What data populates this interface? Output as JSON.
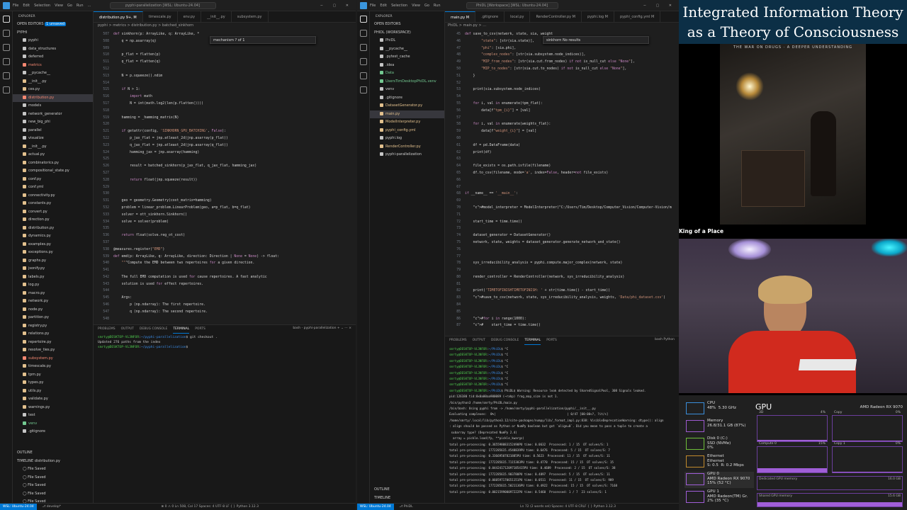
{
  "left_window": {
    "title": "pyphi-parallelization [WSL: Ubuntu-24.04]",
    "menu": [
      "File",
      "Edit",
      "Selection",
      "View",
      "Go",
      "Run",
      "…"
    ],
    "explorer_title": "EXPLORER",
    "open_editors": "OPEN EDITORS",
    "open_editors_badge": "1 unsaved",
    "root": "PYPHI",
    "files": [
      {
        "name": "pyphi",
        "cls": "",
        "dot": "#c5c5c5"
      },
      {
        "name": "data_structures",
        "cls": "",
        "dot": "#c5c5c5"
      },
      {
        "name": "deferred",
        "cls": "",
        "dot": "#c5c5c5"
      },
      {
        "name": "metrics",
        "cls": "err",
        "dot": "#f48771"
      },
      {
        "name": "__pycache__",
        "cls": "",
        "dot": "#c5c5c5"
      },
      {
        "name": "__init__.py",
        "cls": "",
        "dot": "#e2c08d"
      },
      {
        "name": "ces.py",
        "cls": "",
        "dot": "#e2c08d"
      },
      {
        "name": "distribution.py",
        "cls": "err sel",
        "dot": "#f48771"
      },
      {
        "name": "models",
        "cls": "",
        "dot": "#c5c5c5"
      },
      {
        "name": "network_generator",
        "cls": "",
        "dot": "#c5c5c5"
      },
      {
        "name": "new_big_phi",
        "cls": "",
        "dot": "#c5c5c5"
      },
      {
        "name": "parallel",
        "cls": "",
        "dot": "#c5c5c5"
      },
      {
        "name": "visualize",
        "cls": "",
        "dot": "#c5c5c5"
      },
      {
        "name": "__init__.py",
        "cls": "",
        "dot": "#e2c08d"
      },
      {
        "name": "actual.py",
        "cls": "",
        "dot": "#e2c08d"
      },
      {
        "name": "combinatorics.py",
        "cls": "",
        "dot": "#e2c08d"
      },
      {
        "name": "compositional_state.py",
        "cls": "",
        "dot": "#e2c08d"
      },
      {
        "name": "conf.py",
        "cls": "",
        "dot": "#e2c08d"
      },
      {
        "name": "conf.yml",
        "cls": "",
        "dot": "#e2c08d"
      },
      {
        "name": "connectivity.py",
        "cls": "",
        "dot": "#e2c08d"
      },
      {
        "name": "constants.py",
        "cls": "",
        "dot": "#e2c08d"
      },
      {
        "name": "convert.py",
        "cls": "",
        "dot": "#e2c08d"
      },
      {
        "name": "direction.py",
        "cls": "",
        "dot": "#e2c08d"
      },
      {
        "name": "distribution.py",
        "cls": "",
        "dot": "#e2c08d"
      },
      {
        "name": "dynamics.py",
        "cls": "",
        "dot": "#e2c08d"
      },
      {
        "name": "examples.py",
        "cls": "",
        "dot": "#e2c08d"
      },
      {
        "name": "exceptions.py",
        "cls": "",
        "dot": "#e2c08d"
      },
      {
        "name": "graphs.py",
        "cls": "",
        "dot": "#e2c08d"
      },
      {
        "name": "jsonify.py",
        "cls": "",
        "dot": "#e2c08d"
      },
      {
        "name": "labels.py",
        "cls": "",
        "dot": "#e2c08d"
      },
      {
        "name": "log.py",
        "cls": "",
        "dot": "#e2c08d"
      },
      {
        "name": "macro.py",
        "cls": "",
        "dot": "#e2c08d"
      },
      {
        "name": "network.py",
        "cls": "",
        "dot": "#e2c08d"
      },
      {
        "name": "node.py",
        "cls": "",
        "dot": "#e2c08d"
      },
      {
        "name": "partition.py",
        "cls": "",
        "dot": "#e2c08d"
      },
      {
        "name": "registry.py",
        "cls": "",
        "dot": "#e2c08d"
      },
      {
        "name": "relations.py",
        "cls": "",
        "dot": "#e2c08d"
      },
      {
        "name": "repertoire.py",
        "cls": "",
        "dot": "#e2c08d"
      },
      {
        "name": "resolve_ties.py",
        "cls": "",
        "dot": "#e2c08d"
      },
      {
        "name": "subsystem.py",
        "cls": "err",
        "dot": "#f48771"
      },
      {
        "name": "timescale.py",
        "cls": "",
        "dot": "#e2c08d"
      },
      {
        "name": "tpm.py",
        "cls": "",
        "dot": "#e2c08d"
      },
      {
        "name": "types.py",
        "cls": "",
        "dot": "#e2c08d"
      },
      {
        "name": "utils.py",
        "cls": "",
        "dot": "#e2c08d"
      },
      {
        "name": "validate.py",
        "cls": "",
        "dot": "#e2c08d"
      },
      {
        "name": "warnings.py",
        "cls": "",
        "dot": "#e2c08d"
      },
      {
        "name": "test",
        "cls": "",
        "dot": "#c5c5c5"
      },
      {
        "name": "venv",
        "cls": "ok",
        "dot": "#73c991"
      },
      {
        "name": ".gitignore",
        "cls": "",
        "dot": "#c5c5c5"
      }
    ],
    "outline": "OUTLINE",
    "timeline": "TIMELINE  distribution.py",
    "timeline_items": [
      "File Saved",
      "File Saved",
      "File Saved",
      "File Saved",
      "File Saved"
    ],
    "tabs": [
      {
        "label": "distribution.py  9+, M",
        "on": true
      },
      {
        "label": "timescale.py",
        "on": false
      },
      {
        "label": "env.py",
        "on": false
      },
      {
        "label": "__init__.py",
        "on": false
      },
      {
        "label": "subsystem.py",
        "on": false
      }
    ],
    "breadcrumb": "pyphi > metrics > distribution.py > batched_sinkhorn",
    "find_widget": "mechanism            ? of 1",
    "line_numbers": "507\n508\n509\n510\n511\n512\n513\n514\n515\n516\n517\n518\n519\n520\n521\n522\n523\n524\n525\n526\n527\n528\n529\n530\n531\n532\n533\n534\n535\n536\n537\n538\n539\n540\n541\n542\n543\n544\n545\n546\n547\n548\n549\n550\n551",
    "code": [
      "def sinkhorn(p: ArrayLike, q: ArrayLike, *",
      "    q = np.asarray(q)",
      "",
      "    p_flat = flatten(p)",
      "    q_flat = flatten(q)",
      "",
      "    N = p.squeeze().ndim",
      "",
      "    if N > 1:",
      "        import math",
      "        N = int(math.log2(len(p.flatten())))",
      "",
      "    hamming = _hamming_matrix(N)",
      "",
      "    if getattr(config, 'SINKHORN_GPU_BATCHING', False):",
      "        p_jax_flat = jnp.atleast_2d(jnp.asarray(p_flat))",
      "        q_jax_flat = jnp.atleast_2d(jnp.asarray(q_flat))",
      "        hamming_jax = jnp.asarray(hamming)",
      "",
      "        result = batched_sinkhorn(p_jax_flat, q_jax_flat, hamming_jax)",
      "",
      "        return float(jnp.squeeze(result))",
      "",
      "",
      "    geo = geometry.Geometry(cost_matrix=hamming)",
      "    problem = linear_problem.LinearProblem(geo, a=p_flat, b=q_flat)",
      "    solver = ott_sinkhorn.Sinkhorn()",
      "    solve = solver(problem)",
      "",
      "    return float(solve.reg_ot_cost)",
      "",
      "@measures.register(\"EMD\")",
      "def emd(p: ArrayLike, q: ArrayLike, direction: Direction | None = None) -> float:",
      "    \"\"\"Compute the EMD between two repertoires for a given direction.",
      "",
      "    The full EMD computation is used for cause repertoires. A fast analytic",
      "    solution is used for effect repertoires.",
      "",
      "    Args:",
      "        p (np.ndarray): The first repertoire.",
      "        q (np.ndarray): The second repertoire."
    ],
    "panel_tabs": [
      "PROBLEMS",
      "OUTPUT",
      "DEBUG CONSOLE",
      "TERMINAL",
      "PORTS"
    ],
    "panel_right": "bash - pyphi-parallelization  +  ⌄  ⋯  ×",
    "terminal": [
      "smrty@DESKTOP-VL3NFOR:~/pyphi-parallelization$ git checkout .",
      "Updated 276 paths from the index",
      "smrty@DESKTOP-VL3NFOR:~/pyphi-parallelization$ "
    ],
    "status": "⊗ 0 ⚠ 0    Ln 508, Col 17   Spaces: 4   UTF-8   LF   { } Python   3.12.3",
    "remote": "WSL: Ubuntu-24.04",
    "branch": "⎇ develop*"
  },
  "middle_window": {
    "title": "PhiDL [Workspace] [WSL: Ubuntu-24.04]",
    "explorer_title": "EXPLORER",
    "open_editors": "OPEN EDITORS",
    "root": "PHIDL (WORKSPACE)",
    "files": [
      {
        "name": "PhiDL",
        "cls": "",
        "dot": "#c5c5c5"
      },
      {
        "name": "__pycache__",
        "cls": "",
        "dot": "#c5c5c5"
      },
      {
        "name": ".pytest_cache",
        "cls": "",
        "dot": "#c5c5c5"
      },
      {
        "name": ".idea",
        "cls": "",
        "dot": "#c5c5c5"
      },
      {
        "name": "Data",
        "cls": "ok",
        "dot": "#73c991"
      },
      {
        "name": "UsersTimDesktopPhiDL.venv",
        "cls": "ok",
        "dot": "#73c991"
      },
      {
        "name": "venv",
        "cls": "",
        "dot": "#c5c5c5"
      },
      {
        "name": ".gitignore",
        "cls": "",
        "dot": "#c5c5c5"
      },
      {
        "name": "DatasetGenerator.py",
        "cls": "mod",
        "dot": "#e2c08d"
      },
      {
        "name": "main.py",
        "cls": "mod sel",
        "dot": "#e2c08d"
      },
      {
        "name": "ModelInterpreter.py",
        "cls": "mod",
        "dot": "#e2c08d"
      },
      {
        "name": "pyphi_config.yml",
        "cls": "mod",
        "dot": "#e2c08d"
      },
      {
        "name": "pyphi.log",
        "cls": "",
        "dot": "#c5c5c5"
      },
      {
        "name": "RenderController.py",
        "cls": "mod",
        "dot": "#e2c08d"
      },
      {
        "name": "pyphi-parallelization",
        "cls": "",
        "dot": "#c5c5c5"
      }
    ],
    "outline": "OUTLINE",
    "timeline": "TIMELINE",
    "tabs": [
      {
        "label": "main.py  M",
        "on": true
      },
      {
        "label": ".gitignore",
        "on": false
      },
      {
        "label": "local.py",
        "on": false
      },
      {
        "label": "RenderController.py  M",
        "on": false
      },
      {
        "label": "pyphi.log  M",
        "on": false
      },
      {
        "label": "pyphi_config.yml  M",
        "on": false
      }
    ],
    "breadcrumb": "PhiDL > main.py > …",
    "find_widget": "sinkhorn              No results",
    "line_numbers": "45\n46\n47\n48\n49\n50\n51\n52\n53\n54\n55\n56\n57\n58\n59\n60\n61\n62\n63\n64\n65\n66\n67\n68\n69\n70\n71\n72\n73\n74\n75\n76\n77\n78\n79\n80\n81\n82\n83\n84\n85\n86\n87",
    "code": [
      "def save_to_csv(network, state, sia, weight",
      "        \"state\": [str(sia.state)],",
      "        \"phi\": [sia.phi],",
      "        \"complex_nodes\": [str(sia.subsystem.node_indices)],",
      "        \"MIP_from_nodes\": [str(sia.cut.from_nodes) if not is_null_cut else \"None\"],",
      "        \"MIP_to_nodes\": [str(sia.cut.to_nodes) if not is_null_cut else \"None\"],",
      "    }",
      "",
      "    print(sia.subsystem.node_indices)",
      "",
      "    for i, val in enumerate(tpm_flat):",
      "        data[f\"tpm_{i}\"] = [val]",
      "",
      "    for i, val in enumerate(weights_flat):",
      "        data[f\"weight_{i}\"] = [val]",
      "",
      "    df = pd.DataFrame(data)",
      "    print(df)",
      "",
      "    file_exists = os.path.isfile(filename)",
      "    df.to_csv(filename, mode='a', index=False, header=not file_exists)",
      "",
      "",
      "if __name__ == '__main__':",
      "",
      "    #model_interpreter = ModelInterpreter(\"C:/Users/Tim/Desktop/Computer_Vision/Computer-Vision/m",
      "",
      "    start_time = time.time()",
      "",
      "    dataset_generator = DatasetGenerator()",
      "    network, state, weights = dataset_generator.generate_network_and_state()",
      "",
      "",
      "    sys_irreducibility_analysis = pyphi.compute.major_complex(network, state)",
      "",
      "    render_controller = RenderController(network, sys_irreducibility_analysis)",
      "",
      "    print('TIMETOFINISHTIMETOFINISH: ' + str(time.time() - start_time))",
      "    #save_to_csv(network, state, sys_irreducibility_analysis, weights, 'Data/phi_dataset.csv')",
      "",
      "",
      "    #for i in range(1000):",
      "    #    start_time = time.time()"
    ],
    "panel_tabs": [
      "PROBLEMS",
      "OUTPUT",
      "DEBUG CONSOLE",
      "TERMINAL",
      "PORTS"
    ],
    "panel_right": "bash  Python",
    "terminal": [
      "smrty@DESKTOP-VL3NFOR:~/PhiDL$ ^C",
      "smrty@DESKTOP-VL3NFOR:~/PhiDL$ ^C",
      "smrty@DESKTOP-VL3NFOR:~/PhiDL$ ^C",
      "smrty@DESKTOP-VL3NFOR:~/PhiDL$ ^C",
      "smrty@DESKTOP-VL3NFOR:~/PhiDL$ ^C",
      "smrty@DESKTOP-VL3NFOR:~/PhiDL$ ^C",
      "smrty@DESKTOP-VL3NFOR:~/PhiDL$ ^C",
      "smrty@DESKTOP-VL3NFOR:~/PhiDL$ PhiDL$ Warning: Resource leak detected by SharedSignalPool, 308 Signals leaked.",
      "pid:126180 tid:0x0a00aa900089 (~rahp) frag_map_size is not 1.",
      "/bin/python3 /home/smrty/PhiDL/main.py",
      "/bin/bash: Using pyphi from -> /home/smrty/pyphi-parallelization/pyphi/__init__.py",
      "Evaluating complexes:  0%|                                        | 0/47 [00:00<?, ?it/s]",
      "/home/smrty/.local/lib/python3.12/site-packages/numpy/lib/_format_impl.py:838: VisibleDeprecationWarning: dtype(): align",
      ": align should be passed as Python or NumPy boolean but got `align=0`. Did you mean to pass a tuple to create a",
      " subarray type? (Deprecated NumPy 2.4)",
      "  array = pickle.load(fp, **pickle_kwargs)",
      "total pre-processing: 0.365598083152490PU time: 0.0632  Processed: 1 / 15  OT solves/S: 1",
      "total pre-processing: 1772285615.4548839PU time: 0.6476  Processed: 5 / 15  OT solves/S: 7",
      "total pre-processing: 0.33669507821885PU time: 0.5623  Processed: 11 / 15  OT solves/S: 11",
      "total pre-processing: 1772285615.7115383PU time: 0.4770  Processed: 15 / 15  OT solves/S: 15",
      "total pre-processing: 0.044241712097185415PU time: 0.4689  Processed: 2 / 15  OT solves/S: 38",
      "total pre-processing: 1772285615.903780PU time: 0.4897  Processed: 5 / 15  OT solves/S: 11",
      "total pre-processing: 0.060597170651151PU time: 0.0511  Processed: 11 / 15  OT solves/S: 989",
      "total pre-processing: 1772285615.5021136PU time: 0.4922  Processed: 15 / 15  OT solves/S: 7168",
      "total pre-processing: 0.002159900097222PU time: 0.5460  Processed: 1 / 7  23 solves/S: 1"
    ],
    "status": "Ln 72 (2 words sel)   Spaces: 4   UTF-8   CRLF   { } Python   3.12.3",
    "remote": "WSL: Ubuntu-24.04",
    "branch": "⎇ PhiDL"
  },
  "right_panel": {
    "banner": "Integrated Information Theory as a Theory of Consciousness",
    "album_text": "THE WAR ON DRUGS · A DEEPER UNDERSTANDING",
    "song": "King of a Place",
    "task_manager": {
      "title": "GPU",
      "gpu_name": "AMD Radeon RX 9070",
      "items": [
        {
          "label": "CPU",
          "sub": "48%  5.30 GHz"
        },
        {
          "label": "Memory",
          "sub": "26.8/31.1 GB (87%)"
        },
        {
          "label": "Disk 0 (C:)",
          "sub": "SSD (NVMe)\n0%"
        },
        {
          "label": "Ethernet",
          "sub": "Ethernet\nS: 0.5  R: 0.2 Mbps"
        },
        {
          "label": "GPU 0",
          "sub": "AMD Radeon RX 9070\n15% (52 °C)"
        },
        {
          "label": "GPU 1",
          "sub": "AMD Radeon(TM) Gr.\n2% (35 °C)"
        }
      ],
      "graphs": [
        {
          "label": "3D",
          "pct": "4%"
        },
        {
          "label": "Copy",
          "pct": "0%"
        },
        {
          "label": "Compute 0",
          "pct": "15%"
        },
        {
          "label": "Copy 1",
          "pct": "0%"
        }
      ],
      "dedicated_label": "Dedicated GPU memory",
      "dedicated_value": "16.0 GB",
      "shared_label": "Shared GPU memory",
      "shared_value": "15.6 GB"
    }
  },
  "colors": {
    "accent": "#0078d4",
    "remote_bg": "#0078d4",
    "tm_graph": "#a05ed8"
  }
}
